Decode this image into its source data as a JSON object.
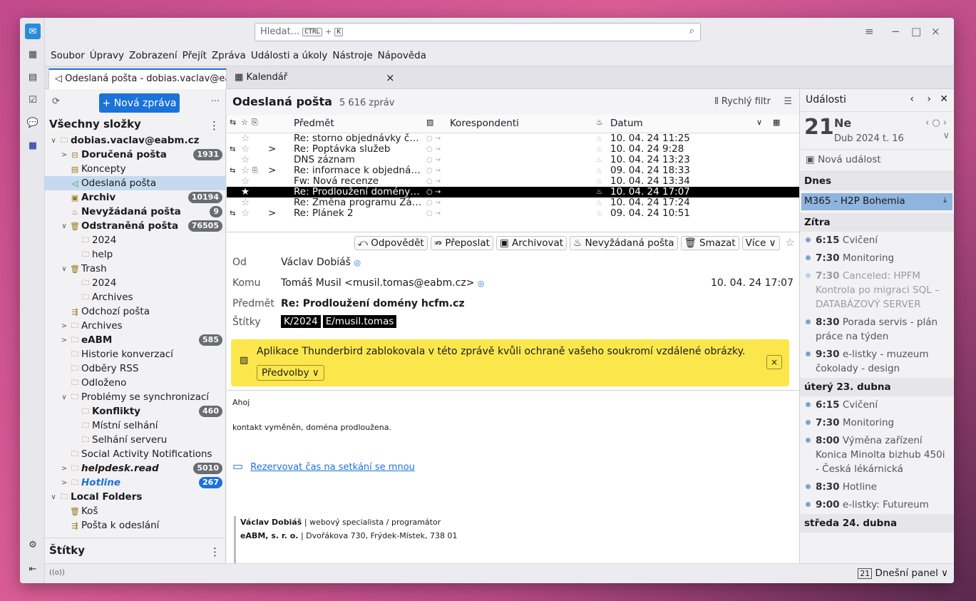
{
  "window": {
    "search": {
      "placeholder": "Hledat...",
      "shortcut_key1": "CTRL",
      "shortcut_plus": "+",
      "shortcut_key2": "K"
    },
    "controls": {
      "menu": "≡",
      "minimize": "−",
      "maximize": "□",
      "close": "×"
    }
  },
  "menu": [
    "Soubor",
    "Úpravy",
    "Zobrazení",
    "Přejít",
    "Zpráva",
    "Události a úkoly",
    "Nástroje",
    "Nápověda"
  ],
  "tabs": [
    {
      "label": "Odeslaná pošta - dobias.vaclav@eabm.cz"
    },
    {
      "label": "Kalendář",
      "close": "×"
    }
  ],
  "folder_pane": {
    "new_message": "+ Nová zpráva",
    "more": "···",
    "all_folders": "Všechny složky",
    "tags_title": "Štítky",
    "folders": [
      {
        "name": "dobias.vaclav@eabm.cz",
        "level": 0,
        "twisty": "∨",
        "bold": true,
        "icon": "🗀"
      },
      {
        "name": "Doručená pošta",
        "level": 1,
        "twisty": ">",
        "bold": true,
        "count": "1931",
        "icon": "⊟"
      },
      {
        "name": "Koncepty",
        "level": 1,
        "icon": "▤"
      },
      {
        "name": "Odeslaná pošta",
        "level": 1,
        "selected": true,
        "icon": "◁"
      },
      {
        "name": "Archiv",
        "level": 1,
        "bold": true,
        "count": "10194",
        "icon": "▣"
      },
      {
        "name": "Nevyžádaná pošta",
        "level": 1,
        "bold": true,
        "count": "9",
        "icon": "♨"
      },
      {
        "name": "Odstraněná pošta",
        "level": 1,
        "twisty": "∨",
        "bold": true,
        "count": "76505",
        "icon": "🗑"
      },
      {
        "name": "2024",
        "level": 2,
        "icon": "🗀"
      },
      {
        "name": "help",
        "level": 2,
        "icon": "🗀"
      },
      {
        "name": "Trash",
        "level": 1,
        "twisty": "∨",
        "icon": "🗑"
      },
      {
        "name": "2024",
        "level": 2,
        "icon": "🗀"
      },
      {
        "name": "Archives",
        "level": 2,
        "icon": "🗀"
      },
      {
        "name": "Odchozí pošta",
        "level": 1,
        "icon": "⇶"
      },
      {
        "name": "Archives",
        "level": 1,
        "twisty": ">",
        "icon": "🗀"
      },
      {
        "name": "eABM",
        "level": 1,
        "twisty": ">",
        "bold": true,
        "count": "585",
        "icon": "🗀"
      },
      {
        "name": "Historie konverzací",
        "level": 1,
        "icon": "🗀"
      },
      {
        "name": "Odběry RSS",
        "level": 1,
        "icon": "🗀"
      },
      {
        "name": "Odloženo",
        "level": 1,
        "icon": "🗀"
      },
      {
        "name": "Problémy se synchronizací",
        "level": 1,
        "twisty": "∨",
        "icon": "🗀"
      },
      {
        "name": "Konflikty",
        "level": 2,
        "bold": true,
        "count": "460",
        "icon": "🗀"
      },
      {
        "name": "Místní selhání",
        "level": 2,
        "icon": "🗀"
      },
      {
        "name": "Selhání serveru",
        "level": 2,
        "icon": "🗀"
      },
      {
        "name": "Social Activity Notifications",
        "level": 1,
        "icon": "🗀"
      },
      {
        "name": "helpdesk.read",
        "level": 1,
        "twisty": ">",
        "bold": true,
        "italic": true,
        "count": "5010",
        "icon": "🗀"
      },
      {
        "name": "Hotline",
        "level": 1,
        "twisty": ">",
        "bold": true,
        "italic": true,
        "blue": true,
        "count": "267",
        "icon": "🗀"
      },
      {
        "name": "Local Folders",
        "level": 0,
        "twisty": "∨",
        "bold": true,
        "icon": "🗀"
      },
      {
        "name": "Koš",
        "level": 1,
        "icon": "🗑"
      },
      {
        "name": "Pošta k odeslání",
        "level": 1,
        "icon": "⇶"
      }
    ]
  },
  "message_list": {
    "title": "Odeslaná pošta",
    "count": "5 616 zpráv",
    "quick_filter": "⫴ Rychlý filtr",
    "columns": {
      "subject": "Předmět",
      "correspondents": "Korespondenti",
      "date": "Datum"
    },
    "rows": [
      {
        "thread": "",
        "twisty": "",
        "subject": "Re: storno objednávky č…",
        "date": "10. 04. 24 11:25"
      },
      {
        "thread": "⇆",
        "twisty": ">",
        "subject": "Re: Poptávka služeb",
        "date": "10. 04. 24 9:28"
      },
      {
        "thread": "",
        "twisty": "",
        "subject": "DNS záznam",
        "date": "10. 04. 24 13:23"
      },
      {
        "thread": "⇆",
        "twisty": ">",
        "subject": "Re: informace k objedná…",
        "date": "09. 04. 24 18:33",
        "attach": true
      },
      {
        "thread": "",
        "twisty": "",
        "subject": "Fw: Nová recenze",
        "date": "10. 04. 24 13:34"
      },
      {
        "thread": "",
        "twisty": "",
        "subject": "Re: Prodloužení domény…",
        "date": "10. 04. 24 17:07",
        "selected": true
      },
      {
        "thread": "",
        "twisty": "",
        "subject": "Re: Změna programu Zá…",
        "date": "10. 04. 24 17:24"
      },
      {
        "thread": "⇆",
        "twisty": ">",
        "subject": "Re: Plánek 2",
        "date": "09. 04. 24 10:51"
      }
    ]
  },
  "message_header": {
    "buttons": [
      "⤺ Odpovědět",
      "⇏ Přeposlat",
      "▣ Archivovat",
      "♨ Nevyžádaná pošta",
      "🗑 Smazat",
      "Více ∨"
    ],
    "from_label": "Od",
    "from": "Václav Dobiáš",
    "to_label": "Komu",
    "to": "Tomáš Musil <musil.tomas@eabm.cz>",
    "date": "10. 04. 24 17:07",
    "subject_label": "Předmět",
    "subject": "Re: Prodloužení domény hcfm.cz",
    "tags_label": "Štítky",
    "tags": [
      "K/2024",
      "E/musil.tomas"
    ],
    "notice": "Aplikace Thunderbird zablokovala v této zprávě kvůli ochraně vašeho soukromí vzdálené obrázky.",
    "notice_button": "Předvolby",
    "notice_close": "×"
  },
  "message_body": {
    "greeting": "Ahoj",
    "text": "kontakt vyměněn, doména prodloužena.",
    "link": "Rezervovat čas na setkání se mnou",
    "sig_name": "Václav Dobiáš",
    "sig_role": " | webový specialista / programátor",
    "sig_company": "eABM, s. r. o.",
    "sig_address": " | Dvořákova 730, Frýdek-Místek, 738 01"
  },
  "today_pane": {
    "title": "Události",
    "day_number": "21",
    "day_name": "Ne",
    "month_week": "Dub 2024 t. 16",
    "new_event": "Nová událost",
    "today_label": "Dnes",
    "today_allday": "M365 - H2P Bohemia",
    "sections": [
      {
        "label": "Zítra",
        "events": [
          {
            "time": "6:15",
            "title": "Cvičení"
          },
          {
            "time": "7:30",
            "title": "Monitoring"
          },
          {
            "time": "7:30",
            "title": "Canceled: HPFM Kontrola po migraci SQL – DATABÁZOVÝ SERVER",
            "cancelled": true
          },
          {
            "time": "8:30",
            "title": "Porada servis - plán práce na týden"
          },
          {
            "time": "9:30",
            "title": "e-listky - muzeum čokolady - design"
          }
        ]
      },
      {
        "label": "úterý 23. dubna",
        "events": [
          {
            "time": "6:15",
            "title": "Cvičení"
          },
          {
            "time": "7:30",
            "title": "Monitoring"
          },
          {
            "time": "8:00",
            "title": "Výměna zařízení Konica Minolta bizhub 450i - Česká lékárnická"
          },
          {
            "time": "8:30",
            "title": "Hotline"
          },
          {
            "time": "9:00",
            "title": "e-listky: Futureum"
          }
        ]
      },
      {
        "label": "středa 24. dubna",
        "events": []
      }
    ],
    "footer": "Dnešní panel ∨"
  },
  "status": {
    "activity": "((o))"
  }
}
